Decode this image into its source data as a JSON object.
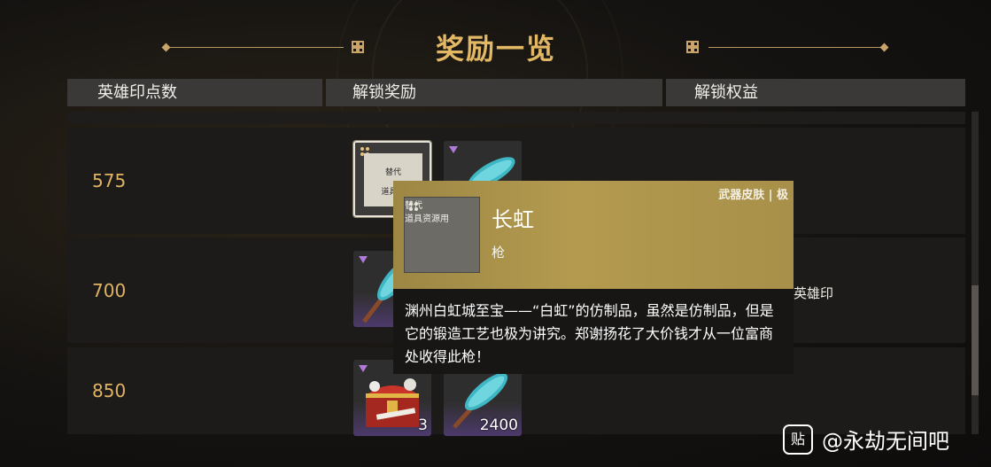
{
  "title": "奖励一览",
  "columns": [
    "英雄印点数",
    "解锁奖励",
    "解锁权益"
  ],
  "rows": [
    {
      "points": "575",
      "benefit": ""
    },
    {
      "points": "700",
      "benefit": "英雄印"
    },
    {
      "points": "850",
      "benefit": ""
    }
  ],
  "rewards": {
    "row575_item1_paper_top": "替代",
    "row575_item1_paper_bottom": "道具资",
    "row850_item1_count": "3",
    "row850_item2_count": "2400"
  },
  "tooltip": {
    "icon_text_top": "替代",
    "icon_text_bottom": "道具资源用",
    "name": "长虹",
    "type": "枪",
    "tag": "武器皮肤 | 极",
    "description": "渊州白虹城至宝——“白虹”的仿制品，虽然是仿制品，但是它的锻造工艺也极为讲究。郑谢扬花了大价钱才从一位富商处收得此枪！"
  },
  "watermark": {
    "icon_label": "贴",
    "text": "@永劫无间吧"
  },
  "colors": {
    "gold_text": "#e0b462",
    "title": "#e3b865",
    "tooltip_gold": "#a8904a",
    "rarity_purple": "#b07ad8"
  },
  "icons": [
    "knot-ornament-icon",
    "rarity-corner-icon",
    "spear-skin-icon",
    "treasure-chest-icon"
  ]
}
